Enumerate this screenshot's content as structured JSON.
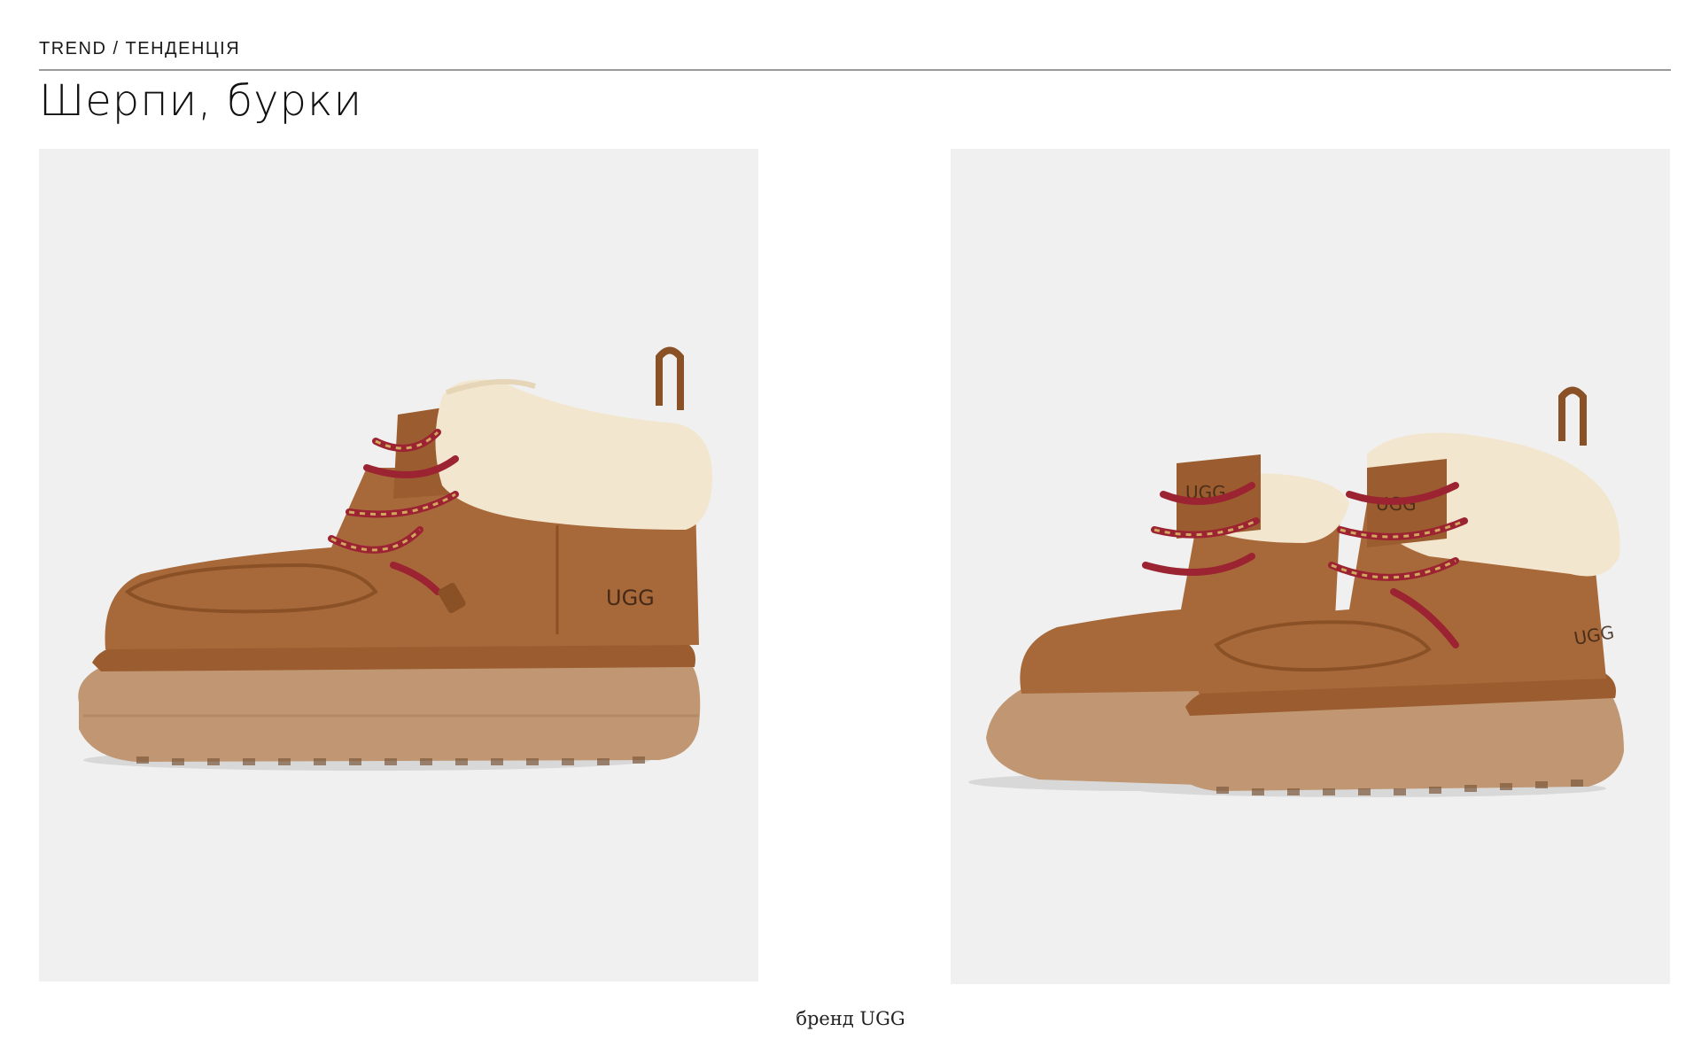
{
  "header": {
    "kicker": "TREND / ТЕНДЕНЦІЯ",
    "title": "Шерпи, бурки"
  },
  "photos": [
    {
      "subject": "single-boot-side-view",
      "brand_mark": "UGG"
    },
    {
      "subject": "pair-of-boots-three-quarter-view",
      "brand_mark": "UGG"
    }
  ],
  "caption": "бренд UGG",
  "colors": {
    "suede": "#a8693a",
    "suede_dark": "#8a5127",
    "sole": "#c09772",
    "fur": "#f3e6cf",
    "lace_red": "#9c2332",
    "photo_bg": "#f0f0f0"
  }
}
